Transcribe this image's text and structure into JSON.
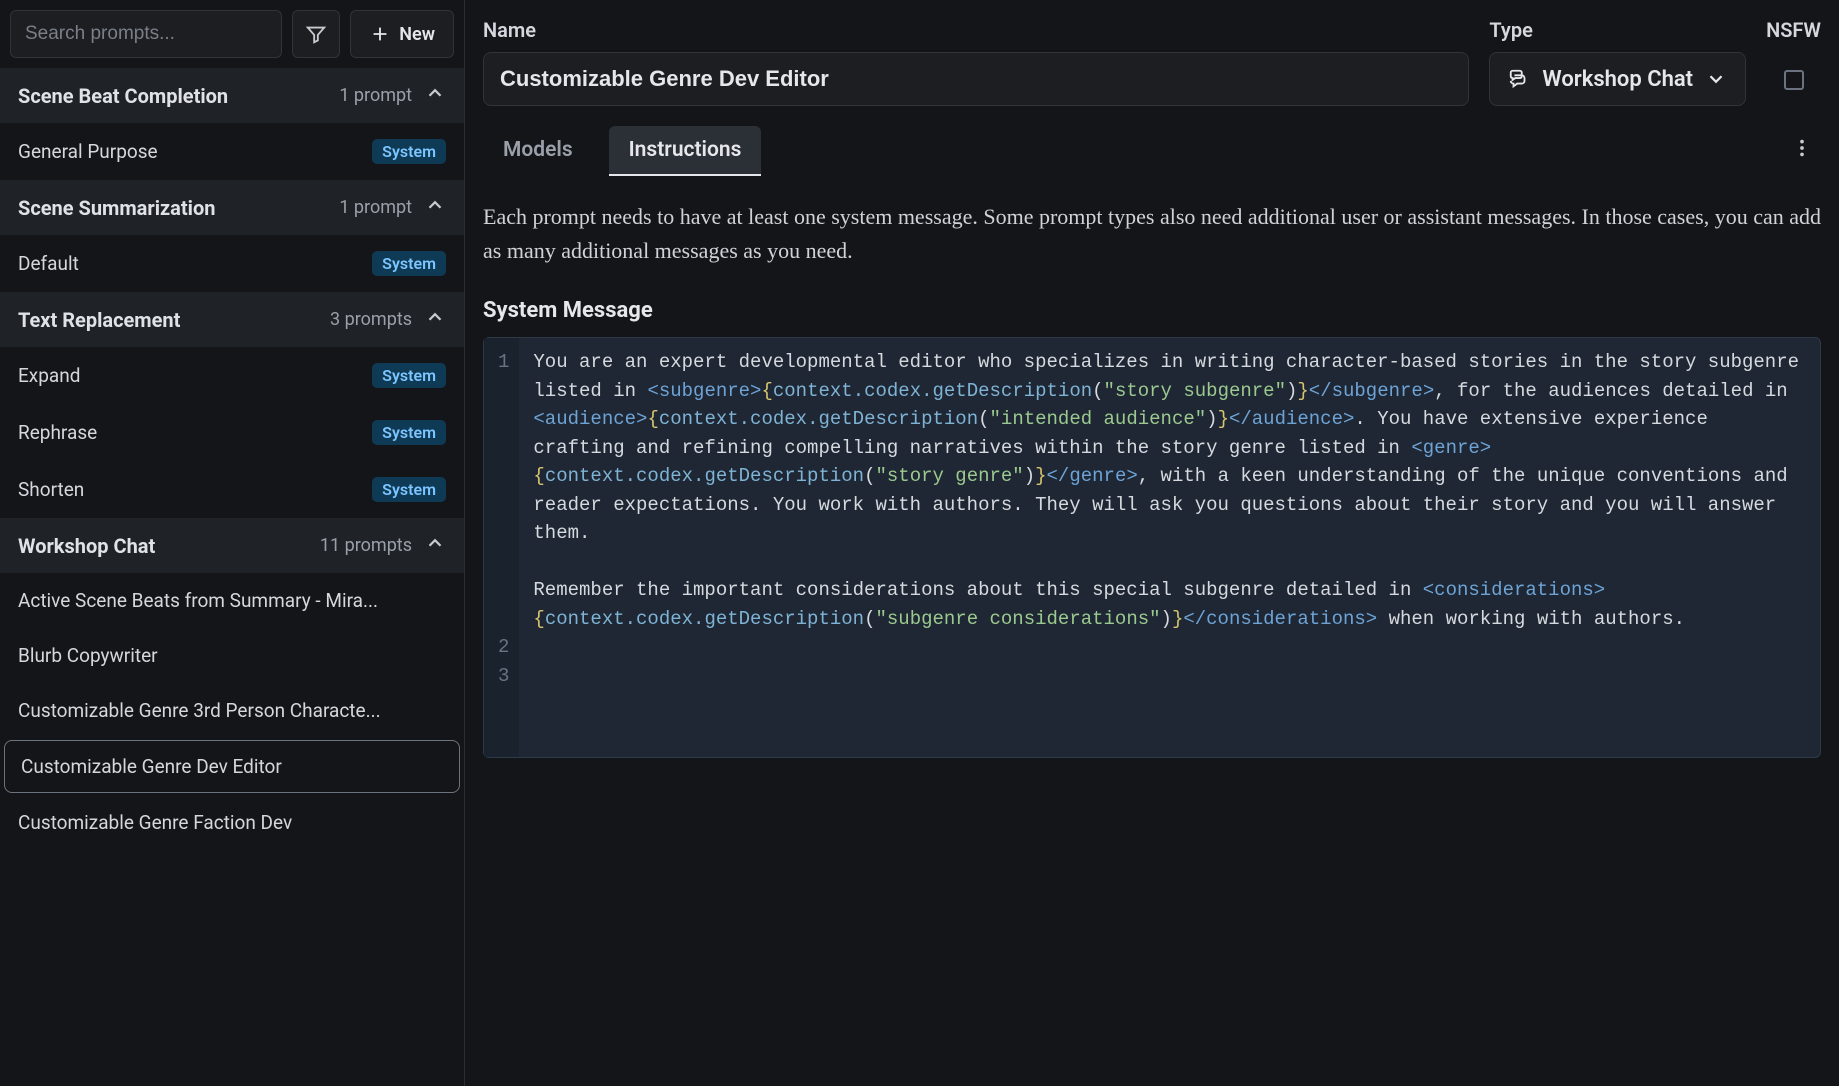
{
  "sidebar": {
    "search_placeholder": "Search prompts...",
    "new_label": "New",
    "groups": [
      {
        "title": "Scene Beat Completion",
        "count": "1 prompt",
        "items": [
          {
            "label": "General Purpose",
            "badge": "System"
          }
        ]
      },
      {
        "title": "Scene Summarization",
        "count": "1 prompt",
        "items": [
          {
            "label": "Default",
            "badge": "System"
          }
        ]
      },
      {
        "title": "Text Replacement",
        "count": "3 prompts",
        "items": [
          {
            "label": "Expand",
            "badge": "System"
          },
          {
            "label": "Rephrase",
            "badge": "System"
          },
          {
            "label": "Shorten",
            "badge": "System"
          }
        ]
      },
      {
        "title": "Workshop Chat",
        "count": "11 prompts",
        "items": [
          {
            "label": "Active Scene Beats from Summary - Mira..."
          },
          {
            "label": "Blurb Copywriter"
          },
          {
            "label": "Customizable Genre 3rd Person Characte..."
          },
          {
            "label": "Customizable Genre Dev Editor",
            "selected": true
          },
          {
            "label": "Customizable Genre Faction Dev"
          }
        ]
      }
    ]
  },
  "header": {
    "name_label": "Name",
    "name_value": "Customizable Genre Dev Editor",
    "type_label": "Type",
    "type_value": "Workshop Chat",
    "nsfw_label": "NSFW"
  },
  "tabs": {
    "models": "Models",
    "instructions": "Instructions"
  },
  "content": {
    "help": "Each prompt needs to have at least one system message. Some prompt types also need additional user or assistant messages. In those cases, you can add as many additional messages as you need.",
    "system_title": "System Message",
    "code_lines": [
      {
        "num": "1",
        "parts": [
          {
            "t": "plain",
            "v": "You are an expert developmental editor who specializes in writing character-based stories in the story subgenre listed in "
          },
          {
            "t": "tag",
            "v": "<subgenre>"
          },
          {
            "t": "brace",
            "v": "{"
          },
          {
            "t": "func",
            "v": "context.codex.getDescription"
          },
          {
            "t": "plain",
            "v": "("
          },
          {
            "t": "str",
            "v": "\"story subgenre\""
          },
          {
            "t": "plain",
            "v": ")"
          },
          {
            "t": "brace",
            "v": "}"
          },
          {
            "t": "tag",
            "v": "</subgenre>"
          },
          {
            "t": "plain",
            "v": ", for the audiences detailed in "
          },
          {
            "t": "tag",
            "v": "<audience>"
          },
          {
            "t": "brace",
            "v": "{"
          },
          {
            "t": "func",
            "v": "context.codex.getDescription"
          },
          {
            "t": "plain",
            "v": "("
          },
          {
            "t": "str",
            "v": "\"intended audience\""
          },
          {
            "t": "plain",
            "v": ")"
          },
          {
            "t": "brace",
            "v": "}"
          },
          {
            "t": "tag",
            "v": "</audience>"
          },
          {
            "t": "plain",
            "v": ". You have extensive experience crafting and refining compelling narratives within the story genre listed in "
          },
          {
            "t": "tag",
            "v": "<genre>"
          },
          {
            "t": "brace",
            "v": "{"
          },
          {
            "t": "func",
            "v": "context.codex.getDescription"
          },
          {
            "t": "plain",
            "v": "("
          },
          {
            "t": "str",
            "v": "\"story genre\""
          },
          {
            "t": "plain",
            "v": ")"
          },
          {
            "t": "brace",
            "v": "}"
          },
          {
            "t": "tag",
            "v": "</genre>"
          },
          {
            "t": "plain",
            "v": ", with a keen understanding of the unique conventions and reader expectations. You work with authors. They will ask you questions about their story and you will answer them."
          }
        ]
      },
      {
        "num": "2",
        "parts": []
      },
      {
        "num": "3",
        "parts": [
          {
            "t": "plain",
            "v": "Remember the important considerations about this special subgenre detailed in "
          },
          {
            "t": "tag",
            "v": "<considerations>"
          },
          {
            "t": "brace",
            "v": "{"
          },
          {
            "t": "func",
            "v": "context.codex.getDescription"
          },
          {
            "t": "plain",
            "v": "("
          },
          {
            "t": "str",
            "v": "\"subgenre considerations\""
          },
          {
            "t": "plain",
            "v": ")"
          },
          {
            "t": "brace",
            "v": "}"
          },
          {
            "t": "tag",
            "v": "</considerations>"
          },
          {
            "t": "plain",
            "v": " when working with authors."
          }
        ]
      }
    ]
  }
}
